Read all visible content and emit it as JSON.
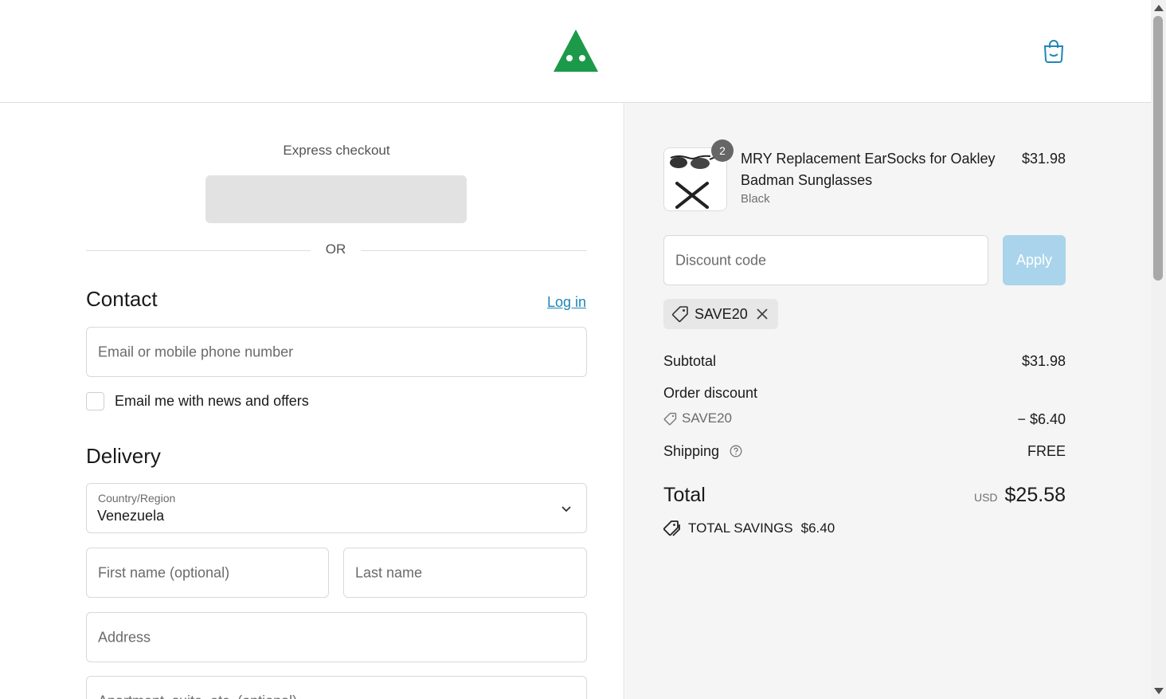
{
  "header": {
    "logo_icon": "brand-triangle-logo",
    "cart_icon": "shopping-bag-icon",
    "brand_color": "#1c9a4a",
    "accent_color": "#1f86b8"
  },
  "express": {
    "title": "Express checkout",
    "or_label": "OR"
  },
  "contact": {
    "title": "Contact",
    "login_label": "Log in",
    "email_placeholder": "Email or mobile phone number",
    "newsletter_label": "Email me with news and offers",
    "newsletter_checked": false
  },
  "delivery": {
    "title": "Delivery",
    "country_label": "Country/Region",
    "country_value": "Venezuela",
    "first_name_placeholder": "First name (optional)",
    "last_name_placeholder": "Last name",
    "address_placeholder": "Address",
    "apartment_placeholder": "Apartment, suite, etc. (optional)"
  },
  "summary": {
    "item": {
      "title": "MRY Replacement EarSocks for Oakley Badman Sunglasses",
      "variant": "Black",
      "price": "$31.98",
      "quantity": "2"
    },
    "discount_placeholder": "Discount code",
    "apply_label": "Apply",
    "applied_code": "SAVE20",
    "subtotal_label": "Subtotal",
    "subtotal_value": "$31.98",
    "order_discount_label": "Order discount",
    "discount_code": "SAVE20",
    "discount_value": "− $6.40",
    "shipping_label": "Shipping",
    "shipping_value": "FREE",
    "total_label": "Total",
    "currency": "USD",
    "total_value": "$25.58",
    "savings_label": "TOTAL SAVINGS",
    "savings_value": "$6.40"
  }
}
